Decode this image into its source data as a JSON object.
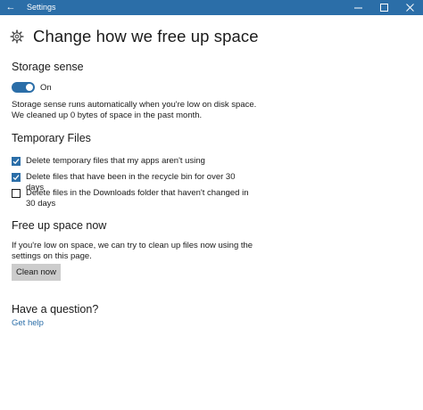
{
  "window": {
    "title": "Settings",
    "back_icon": "back-arrow-icon",
    "controls": [
      "minimize-icon",
      "maximize-icon",
      "close-icon"
    ]
  },
  "header": {
    "icon": "gear-icon",
    "title": "Change how we free up space"
  },
  "storage_sense": {
    "heading": "Storage sense",
    "toggle_state": "On",
    "description_line1": "Storage sense runs automatically when you're low on disk space.",
    "description_line2": "We cleaned up 0 bytes of space in the past month."
  },
  "temporary_files": {
    "heading": "Temporary Files",
    "options": [
      {
        "label": "Delete temporary files that my apps aren't using",
        "checked": true
      },
      {
        "label": "Delete files that have been in the recycle bin for over 30 days",
        "checked": true
      },
      {
        "label": "Delete files in the Downloads folder that haven't changed in 30 days",
        "checked": false
      }
    ]
  },
  "free_up": {
    "heading": "Free up space now",
    "description_line1": "If you're low on space, we can try to clean up files now using the",
    "description_line2": "settings on this page.",
    "button_label": "Clean now"
  },
  "question": {
    "heading": "Have a question?",
    "link": "Get help"
  },
  "colors": {
    "accent": "#2b6ea8",
    "button_bg": "#cccccc",
    "text": "#1a1a1a"
  }
}
